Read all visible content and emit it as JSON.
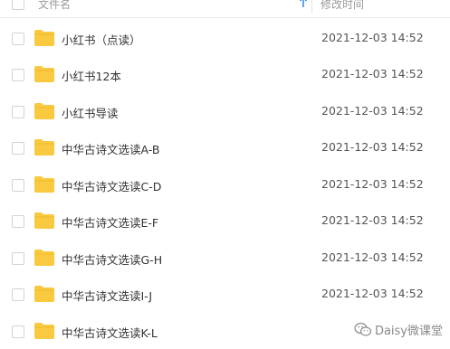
{
  "header": {
    "name_label": "文件名",
    "time_label": "修改时间",
    "sort_direction": "ascending"
  },
  "files": [
    {
      "name": "小红书（点读）",
      "time": "2021-12-03 14:52",
      "type": "folder"
    },
    {
      "name": "小红书12本",
      "time": "2021-12-03 14:52",
      "type": "folder"
    },
    {
      "name": "小红书导读",
      "time": "2021-12-03 14:52",
      "type": "folder"
    },
    {
      "name": "中华古诗文选读A-B",
      "time": "2021-12-03 14:52",
      "type": "folder"
    },
    {
      "name": "中华古诗文选读C-D",
      "time": "2021-12-03 14:52",
      "type": "folder"
    },
    {
      "name": "中华古诗文选读E-F",
      "time": "2021-12-03 14:52",
      "type": "folder"
    },
    {
      "name": "中华古诗文选读G-H",
      "time": "2021-12-03 14:52",
      "type": "folder"
    },
    {
      "name": "中华古诗文选读I-J",
      "time": "2021-12-03 14:52",
      "type": "folder"
    },
    {
      "name": "中华古诗文选读K-L",
      "time": "2021-12-03 14:52",
      "type": "folder"
    }
  ],
  "watermark": {
    "text": "Daisy微课堂",
    "icon": "wechat-icon"
  },
  "colors": {
    "folder": "#F9C940",
    "folder_tab": "#EDB520",
    "sort_arrow": "#3B8FF0",
    "text": "#333333",
    "muted": "#9A9A9A"
  }
}
